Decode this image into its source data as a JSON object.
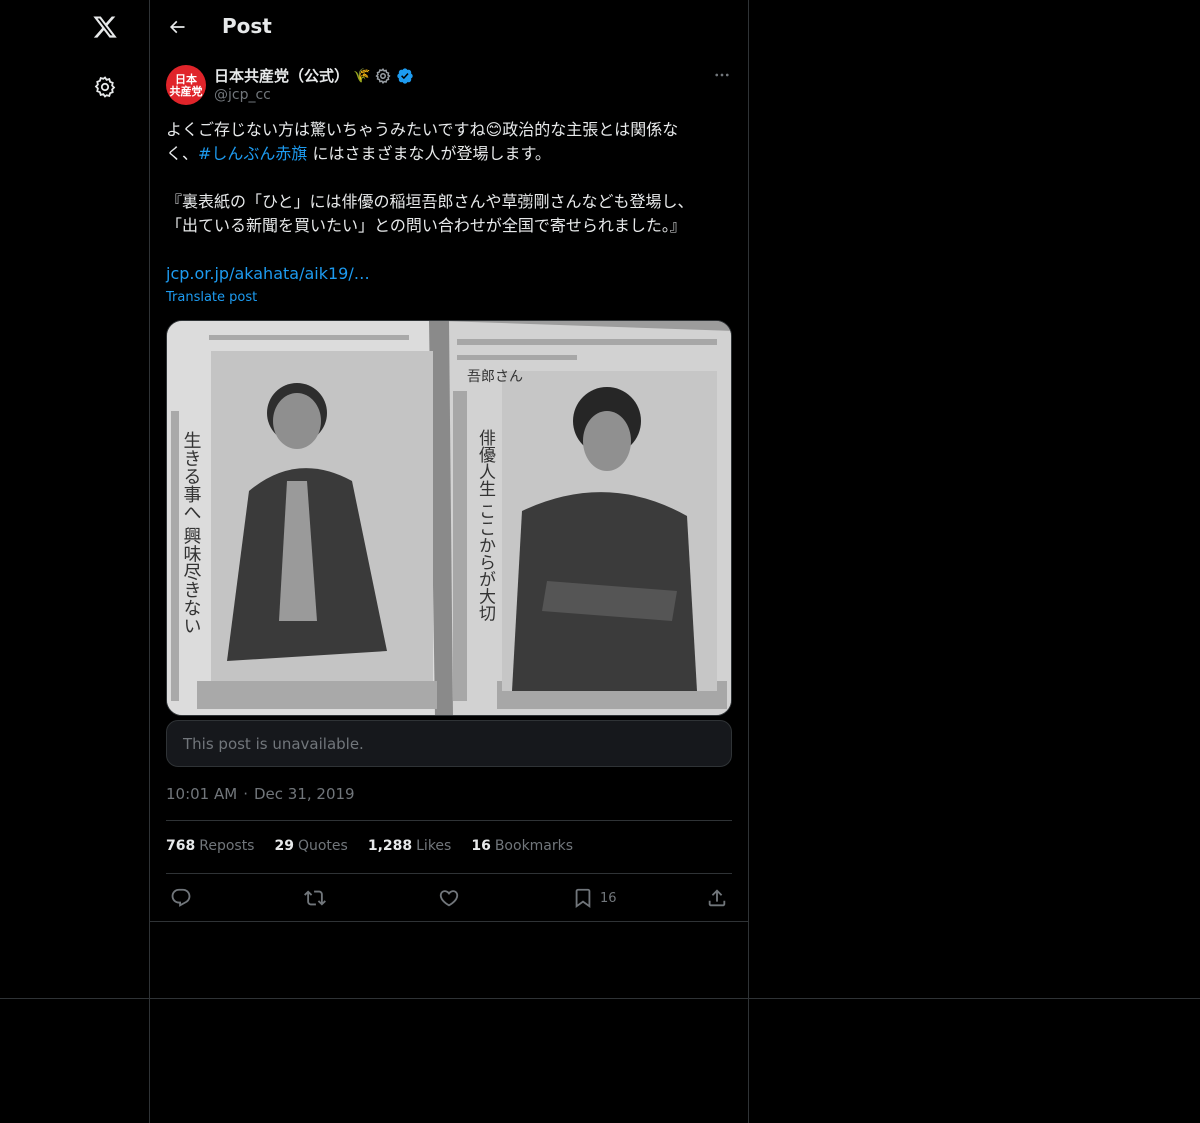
{
  "header": {
    "title": "Post"
  },
  "author": {
    "display_name": "日本共産党（公式）",
    "emoji": "🌾",
    "handle": "@jcp_cc",
    "avatar_text_line1": "日本",
    "avatar_text_line2": "共産党"
  },
  "post": {
    "line1": "よくご存じない方は驚いちゃうみたいですね😊政治的な主張とは関係な",
    "line2_prefix": "く、",
    "hashtag": "#しんぶん赤旗",
    "line2_suffix": " にはさまざまな人が登場します。",
    "quote_line1": "『裏表紙の「ひと」には俳優の稲垣吾郎さんや草彅剛さんなども登場し、",
    "quote_line2": "「出ている新聞を買いたい」との問い合わせが全国で寄せられました。』",
    "link_text": "jcp.or.jp/akahata/aik19/…",
    "translate_label": "Translate post",
    "unavailable_text": "This post is unavailable.",
    "time": "10:01 AM",
    "dot": "·",
    "date": "Dec 31, 2019"
  },
  "media": {
    "left_headline": "生きる事へ 興味尽きない",
    "right_name": "吾郎さん",
    "right_headline": "俳優人生 ここからが大切"
  },
  "stats": {
    "reposts_count": "768",
    "reposts_label": "Reposts",
    "quotes_count": "29",
    "quotes_label": "Quotes",
    "likes_count": "1,288",
    "likes_label": "Likes",
    "bookmarks_count": "16",
    "bookmarks_label": "Bookmarks"
  },
  "actions": {
    "bookmark_count": "16"
  },
  "colors": {
    "background": "#000000",
    "text": "#e7e9ea",
    "muted": "#71767b",
    "accent": "#1d9bf0",
    "border": "#2f3336",
    "avatar_red": "#e0242a"
  },
  "icons": [
    "x-logo-icon",
    "gear-icon",
    "back-arrow-icon",
    "settings-badge-icon",
    "verified-badge-icon",
    "more-icon",
    "reply-icon",
    "repost-icon",
    "like-icon",
    "bookmark-icon",
    "share-icon"
  ]
}
